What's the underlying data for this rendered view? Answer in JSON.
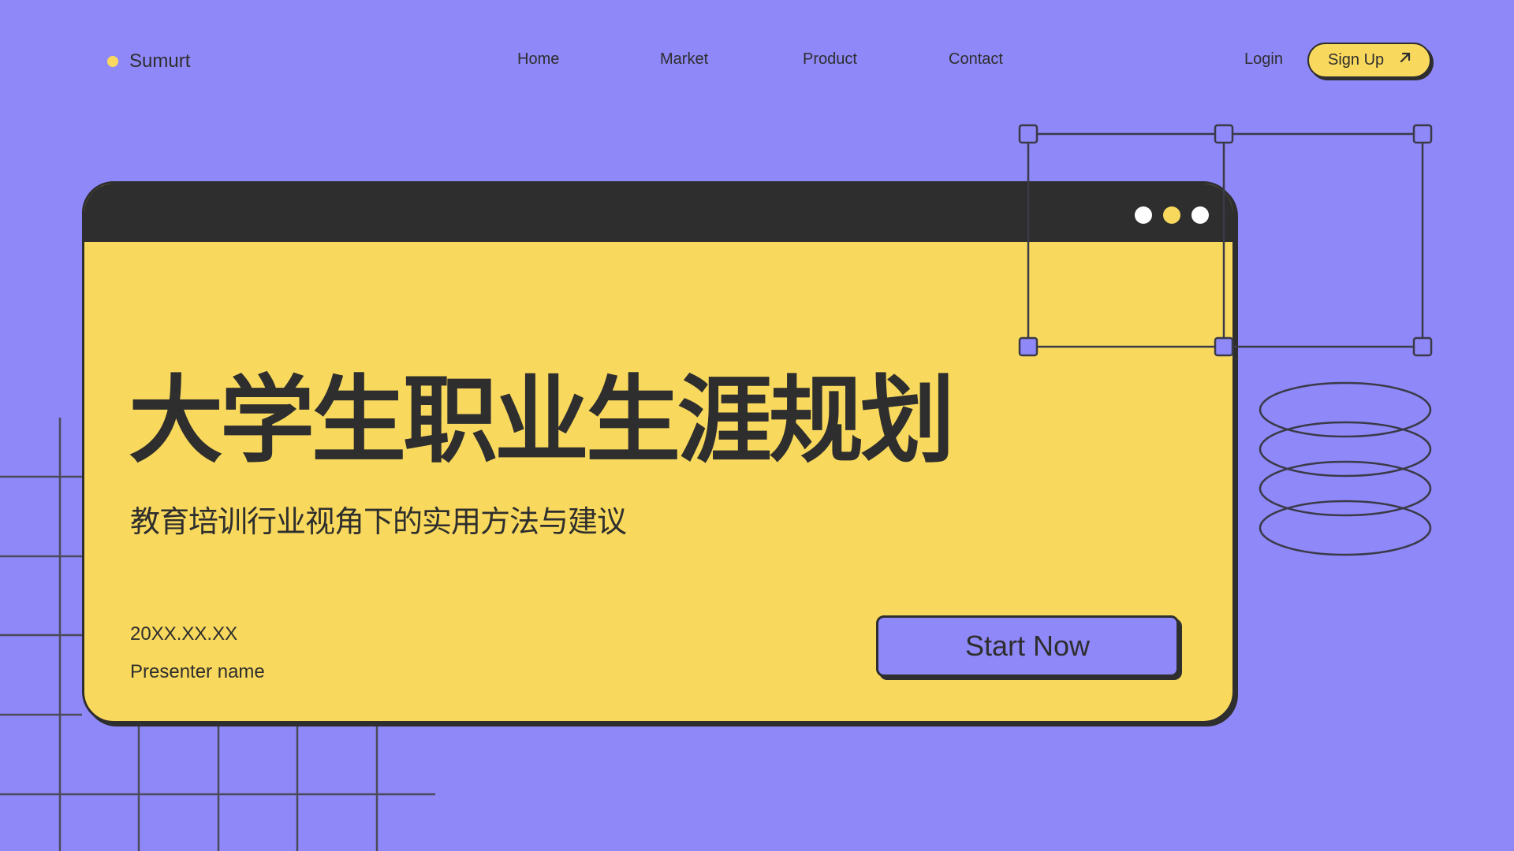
{
  "brand": {
    "name": "Sumurt",
    "dot_icon": "circle-dot-icon"
  },
  "nav": {
    "items": [
      {
        "label": "Home"
      },
      {
        "label": "Market"
      },
      {
        "label": "Product"
      },
      {
        "label": "Contact"
      }
    ],
    "login_label": "Login",
    "signup_label": "Sign Up",
    "signup_icon": "arrow-up-right-icon"
  },
  "card": {
    "title": "大学生职业生涯规划",
    "subtitle": "教育培训行业视角下的实用方法与建议",
    "date": "20XX.XX.XX",
    "presenter": "Presenter name",
    "start_label": "Start Now"
  },
  "colors": {
    "background": "#8f88f8",
    "card": "#f9d95d",
    "dark": "#2e2e2e",
    "button": "#8f88f8"
  }
}
